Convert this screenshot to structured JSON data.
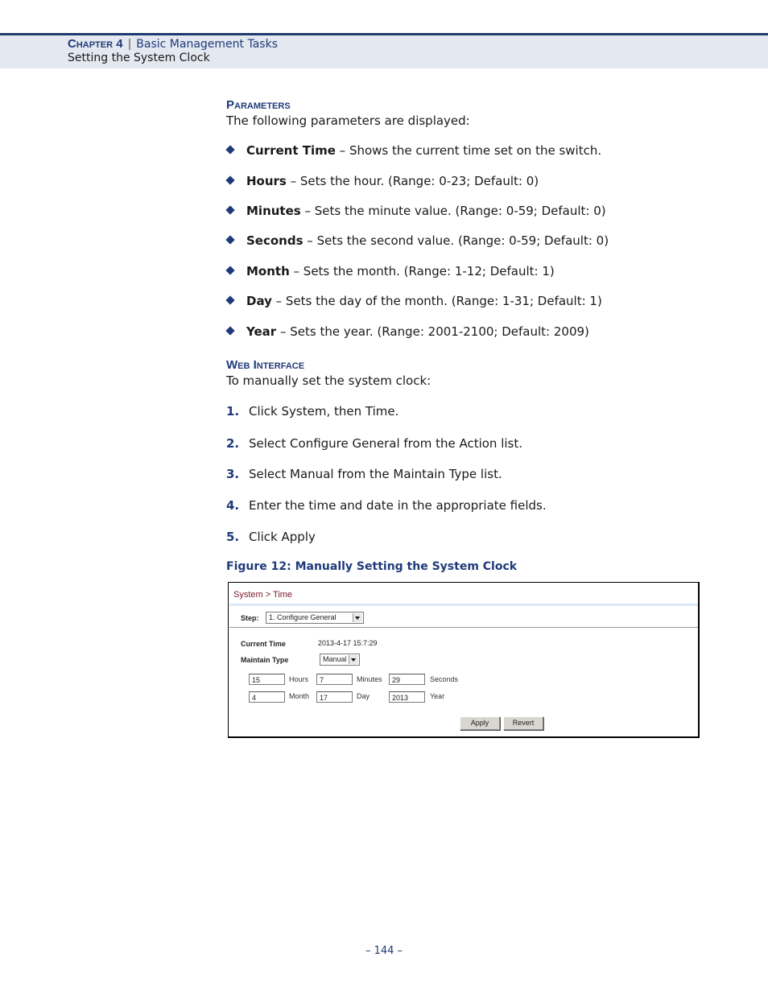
{
  "header": {
    "chapter": "Chapter 4",
    "separator": "|",
    "chapter_title": "Basic Management Tasks",
    "section": "Setting the System Clock"
  },
  "parameters": {
    "heading": "Parameters",
    "intro": "The following parameters are displayed:",
    "items": [
      {
        "term": "Current Time",
        "desc": " – Shows the current time set on the switch."
      },
      {
        "term": "Hours",
        "desc": " – Sets the hour. (Range: 0-23; Default: 0)"
      },
      {
        "term": "Minutes",
        "desc": " – Sets the minute value. (Range: 0-59; Default: 0)"
      },
      {
        "term": "Seconds",
        "desc": " – Sets the second value. (Range: 0-59; Default: 0)"
      },
      {
        "term": "Month",
        "desc": " – Sets the month. (Range: 1-12; Default: 1)"
      },
      {
        "term": "Day",
        "desc": " – Sets the day of the month. (Range: 1-31; Default: 1)"
      },
      {
        "term": "Year",
        "desc": " – Sets the year. (Range: 2001-2100; Default: 2009)"
      }
    ]
  },
  "web_interface": {
    "heading": "Web Interface",
    "intro": "To manually set the system clock:",
    "steps": [
      {
        "num": "1.",
        "text": "Click System, then Time."
      },
      {
        "num": "2.",
        "text": "Select Configure General from the Action list."
      },
      {
        "num": "3.",
        "text": "Select Manual from the Maintain Type list."
      },
      {
        "num": "4.",
        "text": "Enter the time and date in the appropriate fields."
      },
      {
        "num": "5.",
        "text": "Click Apply"
      }
    ]
  },
  "figure": {
    "caption": "Figure 12:  Manually Setting the System Clock",
    "breadcrumb": "System > Time",
    "step_label": "Step:",
    "step_value": "1. Configure General",
    "current_time_label": "Current Time",
    "current_time_value": "2013-4-17 15:7:29",
    "maintain_type_label": "Maintain Type",
    "maintain_type_value": "Manual",
    "fields": {
      "hours": {
        "value": "15",
        "label": "Hours"
      },
      "minutes": {
        "value": "7",
        "label": "Minutes"
      },
      "seconds": {
        "value": "29",
        "label": "Seconds"
      },
      "month": {
        "value": "4",
        "label": "Month"
      },
      "day": {
        "value": "17",
        "label": "Day"
      },
      "year": {
        "value": "2013",
        "label": "Year"
      }
    },
    "apply_label": "Apply",
    "revert_label": "Revert"
  },
  "footer": {
    "page_number": "–  144  –"
  }
}
